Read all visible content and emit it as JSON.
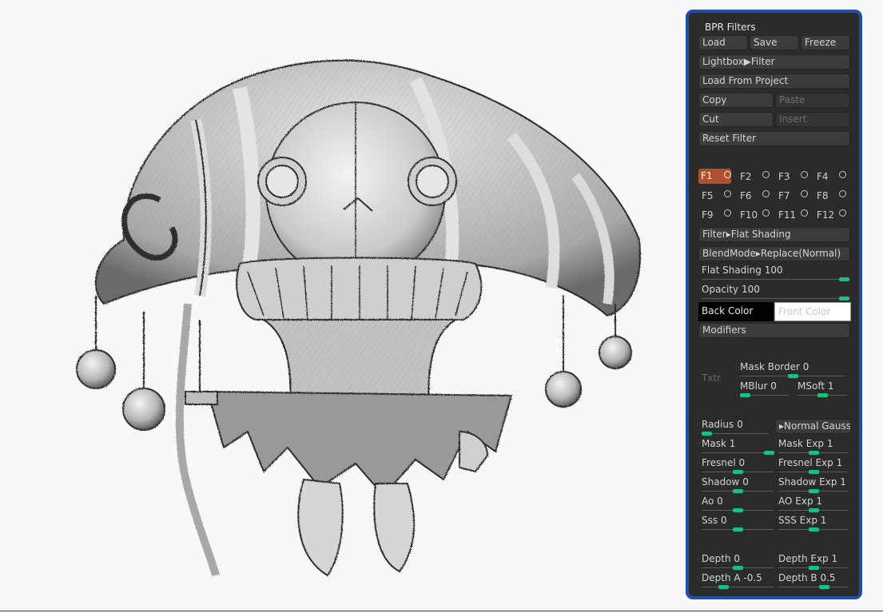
{
  "colors": {
    "panel_bg": "#2b2b2b",
    "panel_border": "#1f4fa8",
    "accent": "#19c080",
    "active_key": "#b0502c"
  },
  "panel": {
    "title": "BPR Filters",
    "buttons": {
      "load": "Load",
      "save": "Save",
      "freeze": "Freeze",
      "lightbox": "Lightbox▶Filter",
      "load_from_project": "Load From Project",
      "copy": "Copy",
      "paste": "Paste",
      "cut": "Cut",
      "insert": "Insert",
      "reset_filter": "Reset Filter"
    },
    "fkeys": [
      "F1",
      "F2",
      "F3",
      "F4",
      "F5",
      "F6",
      "F7",
      "F8",
      "F9",
      "F10",
      "F11",
      "F12"
    ],
    "active_fkey": "F1",
    "filter": "Filter▸Flat Shading",
    "blendmode": "BlendMode▸Replace(Normal)",
    "flat_shading": {
      "label": "Flat Shading",
      "value": "100",
      "level": 1.0
    },
    "opacity": {
      "label": "Opacity",
      "value": "100",
      "level": 1.0
    },
    "back_color": "Back Color",
    "front_color": "Front Color",
    "modifiers": "Modifiers",
    "txtr": "Txtr",
    "mask_border": {
      "label": "Mask Border",
      "value": "0",
      "level": 0.5
    },
    "mblur": {
      "label": "MBlur",
      "value": "0",
      "level": 0.05
    },
    "msoft": {
      "label": "MSoft",
      "value": "1",
      "level": 0.5
    },
    "radius": {
      "label": "Radius",
      "value": "0",
      "level": 0.04
    },
    "normal_gauss": "▸Normal Gauss",
    "mask": {
      "label": "Mask",
      "value": "1",
      "level": 0.95
    },
    "mask_exp": {
      "label": "Mask Exp",
      "value": "1",
      "level": 0.5
    },
    "fresnel": {
      "label": "Fresnel",
      "value": "0",
      "level": 0.5
    },
    "fresnel_exp": {
      "label": "Fresnel Exp",
      "value": "1",
      "level": 0.5
    },
    "shadow": {
      "label": "Shadow",
      "value": "0",
      "level": 0.5
    },
    "shadow_exp": {
      "label": "Shadow Exp",
      "value": "1",
      "level": 0.5
    },
    "ao": {
      "label": "Ao",
      "value": "0",
      "level": 0.5
    },
    "ao_exp": {
      "label": "AO Exp",
      "value": "1",
      "level": 0.5
    },
    "sss": {
      "label": "Sss",
      "value": "0",
      "level": 0.5
    },
    "sss_exp": {
      "label": "SSS Exp",
      "value": "1",
      "level": 0.5
    },
    "depth": {
      "label": "Depth",
      "value": "0",
      "level": 0.5
    },
    "depth_exp": {
      "label": "Depth Exp",
      "value": "1",
      "level": 0.5
    },
    "depth_a": {
      "label": "Depth A",
      "value": "-0.5",
      "level": 0.3
    },
    "depth_b": {
      "label": "Depth B",
      "value": "0.5",
      "level": 0.65
    }
  }
}
